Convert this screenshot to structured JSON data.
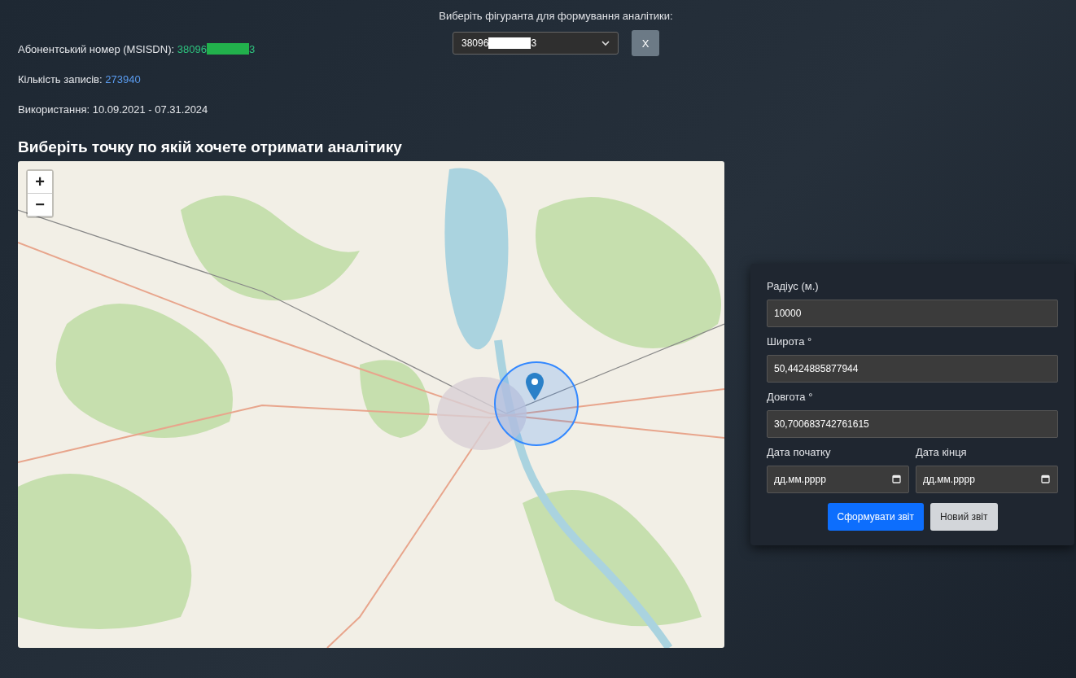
{
  "selector": {
    "label": "Виберіть фігуранта для формування аналітики:",
    "value_prefix": "38096",
    "value_suffix": "3",
    "clear_button": "X"
  },
  "info": {
    "msisdn_label": "Абонентський номер (MSISDN):",
    "msisdn_prefix": "38096",
    "msisdn_suffix": "3",
    "records_label": "Кількість записів:",
    "records_value": "273940",
    "usage": "Використання: 10.09.2021 - 07.31.2024"
  },
  "heading": "Виберіть точку по якій хочете отримати аналітику",
  "map": {
    "zoom_in": "+",
    "zoom_out": "−"
  },
  "form": {
    "fields": [
      {
        "label": "Радіус (м.)",
        "value": "10000"
      },
      {
        "label": "Широта °",
        "value": "50,4424885877944"
      },
      {
        "label": "Довгота °",
        "value": "30,700683742761615"
      }
    ],
    "dates": [
      {
        "label": "Дата початку",
        "placeholder": "дд.мм.рррр"
      },
      {
        "label": "Дата кінця",
        "placeholder": "дд.мм.рррр"
      }
    ],
    "buttons": [
      {
        "label": "Сформувати звіт",
        "kind": "primary"
      },
      {
        "label": "Новий звіт",
        "kind": "secondary"
      }
    ]
  }
}
